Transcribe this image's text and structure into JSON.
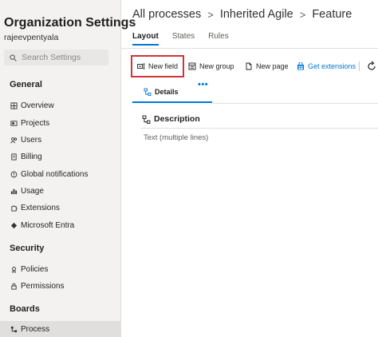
{
  "sidebar": {
    "title": "Organization Settings",
    "user": "rajeevpentyala",
    "search_placeholder": "Search Settings",
    "sections": {
      "general": "General",
      "security": "Security",
      "boards": "Boards"
    },
    "general_items": [
      {
        "label": "Overview",
        "icon": "overview-icon"
      },
      {
        "label": "Projects",
        "icon": "projects-icon"
      },
      {
        "label": "Users",
        "icon": "users-icon"
      },
      {
        "label": "Billing",
        "icon": "billing-icon"
      },
      {
        "label": "Global notifications",
        "icon": "notifications-icon"
      },
      {
        "label": "Usage",
        "icon": "usage-icon"
      },
      {
        "label": "Extensions",
        "icon": "extensions-icon"
      },
      {
        "label": "Microsoft Entra",
        "icon": "entra-icon"
      }
    ],
    "security_items": [
      {
        "label": "Policies",
        "icon": "policies-icon"
      },
      {
        "label": "Permissions",
        "icon": "permissions-icon"
      }
    ],
    "boards_items": [
      {
        "label": "Process",
        "icon": "process-icon",
        "selected": true
      }
    ]
  },
  "breadcrumb": [
    "All processes",
    "Inherited Agile",
    "Feature"
  ],
  "tabs": [
    {
      "label": "Layout",
      "active": true
    },
    {
      "label": "States",
      "active": false
    },
    {
      "label": "Rules",
      "active": false
    }
  ],
  "toolbar": {
    "new_field": "New field",
    "new_group": "New group",
    "new_page": "New page",
    "get_extensions": "Get extensions"
  },
  "page_tab": {
    "label": "Details",
    "more": "•••"
  },
  "group": {
    "title": "Description",
    "field_type": "Text (multiple lines)"
  },
  "colors": {
    "accent": "#0078d4",
    "highlight_border": "#d13438",
    "sidebar_bg": "#f3f2f1"
  }
}
